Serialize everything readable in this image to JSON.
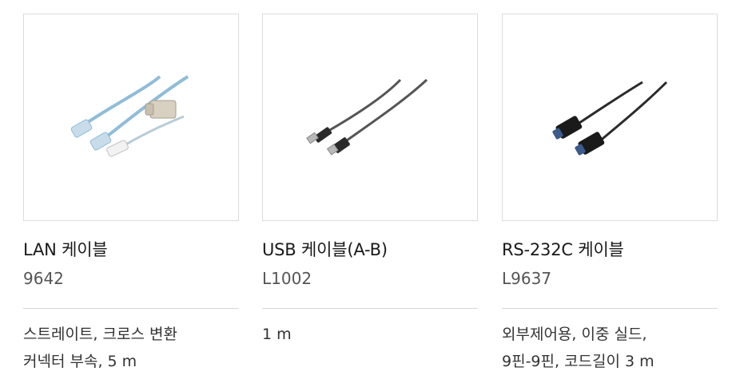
{
  "products": [
    {
      "title": "LAN 케이블",
      "model": "9642",
      "desc": [
        "스트레이트, 크로스 변환",
        "커넥터 부속, 5 m"
      ],
      "image_icon": "lan-cable-icon",
      "colors": {
        "cable": "#8fbcd9",
        "plug": "#c9dcea",
        "coupler": "#d8d0c0"
      }
    },
    {
      "title": "USB 케이블(A-B)",
      "model": "L1002",
      "desc": [
        "1 m"
      ],
      "image_icon": "usb-cable-icon",
      "colors": {
        "cable": "#555555",
        "plug": "#2a2a2a",
        "metal": "#b8b8b8"
      }
    },
    {
      "title": "RS-232C 케이블",
      "model": "L9637",
      "desc": [
        "외부제어용, 이중 실드,",
        "9핀-9핀, 코드길이 3 m"
      ],
      "image_icon": "rs232c-cable-icon",
      "colors": {
        "cable": "#2b2b2b",
        "connector": "#1a1a1a",
        "shell": "#3c5a8a"
      }
    }
  ]
}
